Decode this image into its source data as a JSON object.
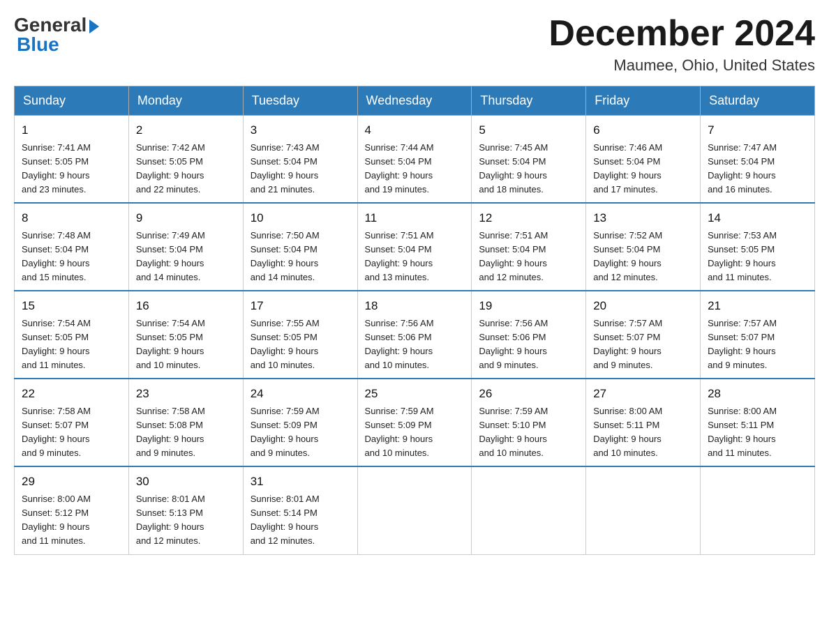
{
  "logo": {
    "general": "General",
    "blue": "Blue"
  },
  "title": "December 2024",
  "location": "Maumee, Ohio, United States",
  "days_of_week": [
    "Sunday",
    "Monday",
    "Tuesday",
    "Wednesday",
    "Thursday",
    "Friday",
    "Saturday"
  ],
  "weeks": [
    [
      {
        "day": "1",
        "sunrise": "7:41 AM",
        "sunset": "5:05 PM",
        "daylight": "9 hours and 23 minutes."
      },
      {
        "day": "2",
        "sunrise": "7:42 AM",
        "sunset": "5:05 PM",
        "daylight": "9 hours and 22 minutes."
      },
      {
        "day": "3",
        "sunrise": "7:43 AM",
        "sunset": "5:04 PM",
        "daylight": "9 hours and 21 minutes."
      },
      {
        "day": "4",
        "sunrise": "7:44 AM",
        "sunset": "5:04 PM",
        "daylight": "9 hours and 19 minutes."
      },
      {
        "day": "5",
        "sunrise": "7:45 AM",
        "sunset": "5:04 PM",
        "daylight": "9 hours and 18 minutes."
      },
      {
        "day": "6",
        "sunrise": "7:46 AM",
        "sunset": "5:04 PM",
        "daylight": "9 hours and 17 minutes."
      },
      {
        "day": "7",
        "sunrise": "7:47 AM",
        "sunset": "5:04 PM",
        "daylight": "9 hours and 16 minutes."
      }
    ],
    [
      {
        "day": "8",
        "sunrise": "7:48 AM",
        "sunset": "5:04 PM",
        "daylight": "9 hours and 15 minutes."
      },
      {
        "day": "9",
        "sunrise": "7:49 AM",
        "sunset": "5:04 PM",
        "daylight": "9 hours and 14 minutes."
      },
      {
        "day": "10",
        "sunrise": "7:50 AM",
        "sunset": "5:04 PM",
        "daylight": "9 hours and 14 minutes."
      },
      {
        "day": "11",
        "sunrise": "7:51 AM",
        "sunset": "5:04 PM",
        "daylight": "9 hours and 13 minutes."
      },
      {
        "day": "12",
        "sunrise": "7:51 AM",
        "sunset": "5:04 PM",
        "daylight": "9 hours and 12 minutes."
      },
      {
        "day": "13",
        "sunrise": "7:52 AM",
        "sunset": "5:04 PM",
        "daylight": "9 hours and 12 minutes."
      },
      {
        "day": "14",
        "sunrise": "7:53 AM",
        "sunset": "5:05 PM",
        "daylight": "9 hours and 11 minutes."
      }
    ],
    [
      {
        "day": "15",
        "sunrise": "7:54 AM",
        "sunset": "5:05 PM",
        "daylight": "9 hours and 11 minutes."
      },
      {
        "day": "16",
        "sunrise": "7:54 AM",
        "sunset": "5:05 PM",
        "daylight": "9 hours and 10 minutes."
      },
      {
        "day": "17",
        "sunrise": "7:55 AM",
        "sunset": "5:05 PM",
        "daylight": "9 hours and 10 minutes."
      },
      {
        "day": "18",
        "sunrise": "7:56 AM",
        "sunset": "5:06 PM",
        "daylight": "9 hours and 10 minutes."
      },
      {
        "day": "19",
        "sunrise": "7:56 AM",
        "sunset": "5:06 PM",
        "daylight": "9 hours and 9 minutes."
      },
      {
        "day": "20",
        "sunrise": "7:57 AM",
        "sunset": "5:07 PM",
        "daylight": "9 hours and 9 minutes."
      },
      {
        "day": "21",
        "sunrise": "7:57 AM",
        "sunset": "5:07 PM",
        "daylight": "9 hours and 9 minutes."
      }
    ],
    [
      {
        "day": "22",
        "sunrise": "7:58 AM",
        "sunset": "5:07 PM",
        "daylight": "9 hours and 9 minutes."
      },
      {
        "day": "23",
        "sunrise": "7:58 AM",
        "sunset": "5:08 PM",
        "daylight": "9 hours and 9 minutes."
      },
      {
        "day": "24",
        "sunrise": "7:59 AM",
        "sunset": "5:09 PM",
        "daylight": "9 hours and 9 minutes."
      },
      {
        "day": "25",
        "sunrise": "7:59 AM",
        "sunset": "5:09 PM",
        "daylight": "9 hours and 10 minutes."
      },
      {
        "day": "26",
        "sunrise": "7:59 AM",
        "sunset": "5:10 PM",
        "daylight": "9 hours and 10 minutes."
      },
      {
        "day": "27",
        "sunrise": "8:00 AM",
        "sunset": "5:11 PM",
        "daylight": "9 hours and 10 minutes."
      },
      {
        "day": "28",
        "sunrise": "8:00 AM",
        "sunset": "5:11 PM",
        "daylight": "9 hours and 11 minutes."
      }
    ],
    [
      {
        "day": "29",
        "sunrise": "8:00 AM",
        "sunset": "5:12 PM",
        "daylight": "9 hours and 11 minutes."
      },
      {
        "day": "30",
        "sunrise": "8:01 AM",
        "sunset": "5:13 PM",
        "daylight": "9 hours and 12 minutes."
      },
      {
        "day": "31",
        "sunrise": "8:01 AM",
        "sunset": "5:14 PM",
        "daylight": "9 hours and 12 minutes."
      },
      null,
      null,
      null,
      null
    ]
  ],
  "labels": {
    "sunrise": "Sunrise:",
    "sunset": "Sunset:",
    "daylight": "Daylight:"
  }
}
